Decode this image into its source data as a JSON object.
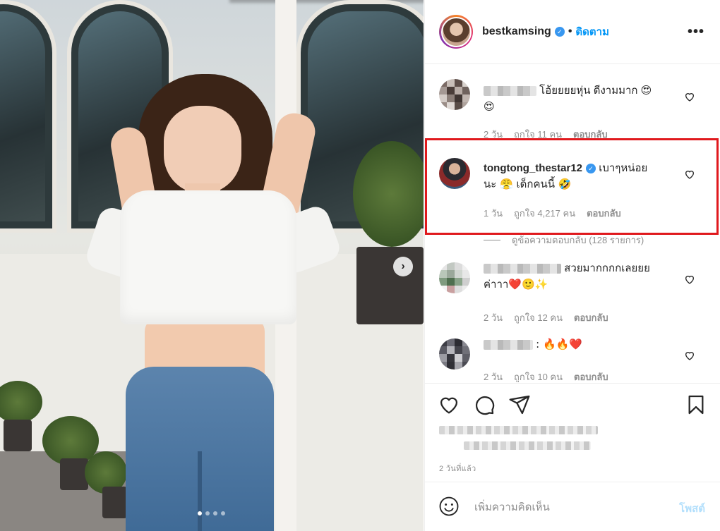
{
  "post": {
    "carousel": {
      "slide_count": 4,
      "active_slide": 1
    }
  },
  "header": {
    "username": "bestkamsing",
    "separator": "•",
    "follow_label": "ติดตาม",
    "more_label": "•••"
  },
  "comments": [
    {
      "username_blurred": true,
      "text": "โอ้ยยยยหุ่น ดีงามมาก 😍",
      "text_line2": "😍",
      "age": "2 วัน",
      "likes": "ถูกใจ 11 คน",
      "reply_label": "ตอบกลับ"
    },
    {
      "username": "tongtong_thestar12",
      "verified": true,
      "text": "เบาๆหน่อย",
      "text_line2": "นะ 😤 เด็กคนนี้ 🤣",
      "age": "1 วัน",
      "likes": "ถูกใจ 4,217 คน",
      "reply_label": "ตอบกลับ",
      "view_replies": "ดูข้อความตอบกลับ (128 รายการ)",
      "highlighted": true
    },
    {
      "username_blurred": true,
      "text": "สวยมากกกกเลยยย",
      "text_line2": "ค่าาา❤️🙂✨",
      "age": "2 วัน",
      "likes": "ถูกใจ 12 คน",
      "reply_label": "ตอบกลับ"
    },
    {
      "username_blurred": true,
      "text": ": 🔥🔥❤️",
      "age": "2 วัน",
      "likes": "ถูกใจ 10 คน",
      "reply_label": "ตอบกลับ"
    }
  ],
  "actions": {
    "like_icon": "heart-icon",
    "comment_icon": "comment-icon",
    "share_icon": "share-icon",
    "save_icon": "bookmark-icon"
  },
  "time_ago": "2 วันที่แล้ว",
  "composer": {
    "placeholder": "เพิ่มความคิดเห็น",
    "post_label": "โพสต์",
    "emoji_icon": "smile-icon"
  },
  "colors": {
    "accent": "#0095f6",
    "highlight_border": "#e0191d",
    "muted": "#8e8e8e",
    "post_disabled": "#b2dffc"
  }
}
